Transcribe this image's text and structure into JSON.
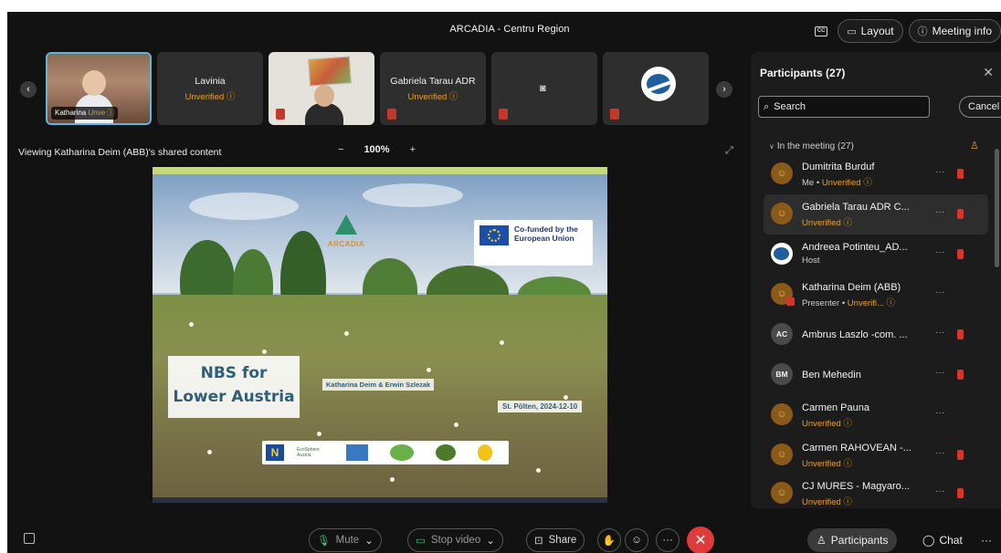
{
  "meeting": {
    "title": "ARCADIA - Centru Region"
  },
  "topbar": {
    "cc_label": "CC",
    "layout_label": "Layout",
    "meeting_info_label": "Meeting info"
  },
  "strip": {
    "tiles": [
      {
        "name": "Katharina",
        "status": "Unve"
      },
      {
        "name": "Lavinia",
        "status": "Unverified"
      },
      {
        "name": "",
        "status": ""
      },
      {
        "name": "Gabriela Tarau ADR",
        "status": "Unverified"
      },
      {
        "name": "",
        "status": ""
      },
      {
        "name": "",
        "status": ""
      }
    ]
  },
  "viewer": {
    "viewing_text": "Viewing Katharina Deim (ABB)'s shared content",
    "zoom_minus": "−",
    "zoom_level": "100%",
    "zoom_plus": "+"
  },
  "slide": {
    "eu_title": "Co-funded by the European Union",
    "arcadia": "ARCADIA",
    "title_line1": "NBS for",
    "title_line2": "Lower Austria",
    "authors": "Katharina Deim & Erwin Szlezak",
    "date": "St. Pölten, 2024-12-10",
    "logo_n": "N",
    "logo_eco": "EcoSphere Austria"
  },
  "panel": {
    "title": "Participants (27)",
    "search_placeholder": "Search",
    "cancel_label": "Cancel",
    "section_label": "In the meeting (27)",
    "participants": [
      {
        "name": "Dumitrita Burduf",
        "sub_prefix": "Me • ",
        "sub_warn": "Unverified",
        "initials": ""
      },
      {
        "name": "Gabriela Tarau ADR C...",
        "sub_prefix": "",
        "sub_warn": "Unverified",
        "initials": ""
      },
      {
        "name": "Andreea Potinteu_AD...",
        "sub_prefix": "Host",
        "sub_warn": "",
        "initials": ""
      },
      {
        "name": "Katharina Deim (ABB)",
        "sub_prefix": "Presenter • ",
        "sub_warn": "Unverifi...",
        "initials": ""
      },
      {
        "name": "Ambrus Laszlo -com. ...",
        "sub_prefix": "",
        "sub_warn": "",
        "initials": "AC"
      },
      {
        "name": "Ben Mehedin",
        "sub_prefix": "",
        "sub_warn": "",
        "initials": "BM"
      },
      {
        "name": "Carmen Pauna",
        "sub_prefix": "",
        "sub_warn": "Unverified",
        "initials": ""
      },
      {
        "name": "Carmen RAHOVEAN -...",
        "sub_prefix": "",
        "sub_warn": "Unverified",
        "initials": ""
      },
      {
        "name": "CJ MURES - Magyaro...",
        "sub_prefix": "",
        "sub_warn": "Unverified",
        "initials": ""
      }
    ]
  },
  "controls": {
    "mute_label": "Mute",
    "stop_video_label": "Stop video",
    "share_label": "Share",
    "participants_label": "Participants",
    "chat_label": "Chat"
  },
  "colors": {
    "accent_warn": "#e8a020",
    "end_call": "#e03b3b",
    "mic_muted": "#d9342b"
  }
}
